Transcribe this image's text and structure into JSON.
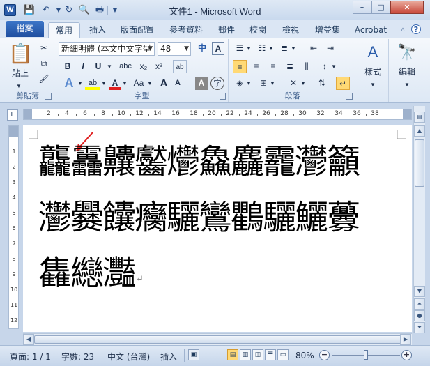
{
  "window": {
    "title": "文件1 - Microsoft Word",
    "app_icon": "W",
    "qat": [
      "save-icon",
      "undo-icon",
      "redo-icon",
      "print-preview-icon",
      "print-icon",
      "customize-icon"
    ],
    "controls": {
      "minimize": "–",
      "maximize": "□",
      "close": "✕"
    }
  },
  "tabs": {
    "file": "檔案",
    "items": [
      "常用",
      "插入",
      "版面配置",
      "參考資料",
      "郵件",
      "校閱",
      "檢視",
      "增益集",
      "Acrobat"
    ],
    "active": "常用"
  },
  "ribbon": {
    "clipboard": {
      "paste_label": "貼上",
      "label": "剪貼簿"
    },
    "font": {
      "font_name": "新細明體 (本文中文字型",
      "font_size": "48",
      "label": "字型",
      "bold": "B",
      "italic": "I",
      "underline": "U",
      "strike": "abc",
      "subscript": "x₂",
      "superscript": "x²",
      "grow": "A",
      "shrink": "A",
      "case": "Aa",
      "phonetic": "中",
      "border_char": "A",
      "enclosed": "字"
    },
    "paragraph": {
      "label": "段落"
    },
    "styles": {
      "label": "樣式"
    },
    "editing": {
      "label": "編輯"
    }
  },
  "ruler": {
    "h_ticks": [
      "2",
      "4",
      "6",
      "8",
      "10",
      "12",
      "14",
      "16",
      "18",
      "20",
      "22",
      "24",
      "26",
      "28",
      "30",
      "32",
      "34",
      "36",
      "38"
    ],
    "v_ticks": [
      "1",
      "2",
      "3",
      "4",
      "5",
      "6",
      "7",
      "8",
      "9",
      "10",
      "11",
      "12"
    ]
  },
  "document": {
    "lines": [
      "龘靐齉齾爩鱻麤龗灪籲",
      "灪爨饢癵驪鸞鸜驪鱺虋",
      "雥纞灩"
    ],
    "paragraph_mark": "↵"
  },
  "status": {
    "page": "頁面: 1 / 1",
    "words": "字數: 23",
    "language": "中文 (台灣)",
    "mode": "插入",
    "zoom": "80%",
    "zoom_fraction": 0.5
  },
  "colors": {
    "accent": "#2a5caa",
    "arrow": "#e02020",
    "highlight": "#ffd975"
  }
}
